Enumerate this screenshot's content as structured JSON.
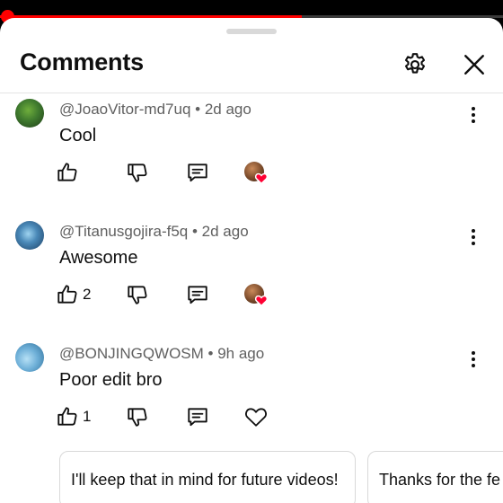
{
  "video": {
    "progress_percent": 60
  },
  "panel": {
    "title": "Comments",
    "settings_icon": "gear-icon",
    "close_icon": "close-icon"
  },
  "comments": [
    {
      "author": "@JoaoVitor-md7uq",
      "age": "2d ago",
      "text": "Cool",
      "likes": "",
      "creator_hearted": true,
      "avatar_color": "#3f7a2e"
    },
    {
      "author": "@Titanusgojira-f5q",
      "age": "2d ago",
      "text": "Awesome",
      "likes": "2",
      "creator_hearted": true,
      "avatar_color": "#4a89b8"
    },
    {
      "author": "@BONJINGQWOSM",
      "age": "9h ago",
      "text": "Poor edit bro",
      "likes": "1",
      "creator_hearted": false,
      "avatar_color": "#6fb0d8"
    }
  ],
  "reply_suggestions": [
    "I'll keep that in mind for future videos!",
    "Thanks for the fe"
  ],
  "colors": {
    "accent": "#ff0000",
    "text": "#0f0f0f",
    "secondary_text": "#606060"
  }
}
